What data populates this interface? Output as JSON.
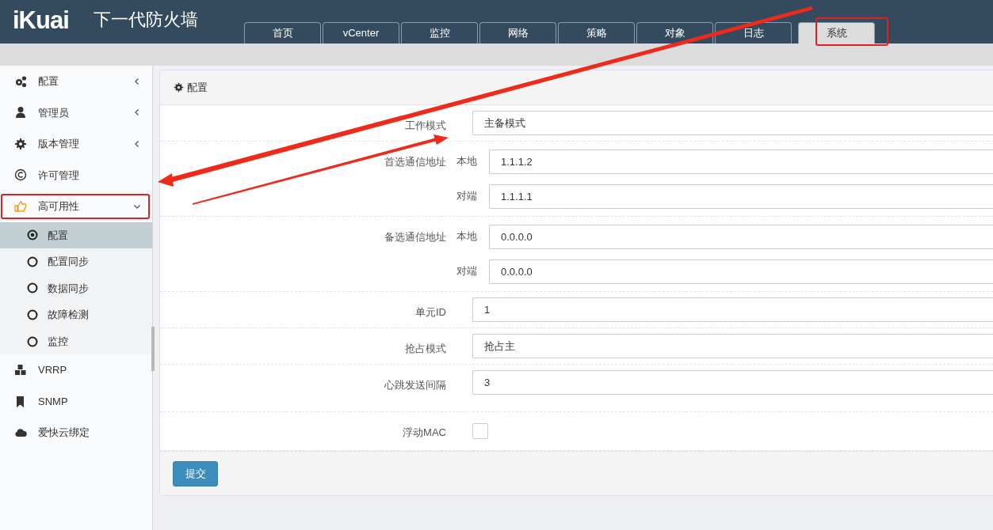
{
  "header": {
    "logo": "iKuai",
    "title": "下一代防火墙",
    "tabs": [
      {
        "label": "首页",
        "selected": false
      },
      {
        "label": "vCenter",
        "selected": false
      },
      {
        "label": "监控",
        "selected": false
      },
      {
        "label": "网络",
        "selected": false
      },
      {
        "label": "策略",
        "selected": false
      },
      {
        "label": "对象",
        "selected": false
      },
      {
        "label": "日志",
        "selected": false
      },
      {
        "label": "系统",
        "selected": true
      }
    ]
  },
  "sidebar": {
    "items": [
      {
        "label": "配置",
        "expanded": false
      },
      {
        "label": "管理员",
        "expanded": false
      },
      {
        "label": "版本管理",
        "expanded": false
      },
      {
        "label": "许可管理"
      },
      {
        "label": "高可用性",
        "expanded": true,
        "children": [
          {
            "label": "配置",
            "selected": true
          },
          {
            "label": "配置同步",
            "selected": false
          },
          {
            "label": "数据同步",
            "selected": false
          },
          {
            "label": "故障检测",
            "selected": false
          },
          {
            "label": "监控",
            "selected": false
          }
        ]
      },
      {
        "label": "VRRP"
      },
      {
        "label": "SNMP"
      },
      {
        "label": "爱快云绑定"
      }
    ]
  },
  "panel": {
    "title": "配置",
    "fields": [
      {
        "kind": "input",
        "label": "工作模式",
        "value": "主备模式"
      },
      {
        "kind": "pair",
        "label": "首选通信地址",
        "rows": [
          {
            "label": "本地",
            "value": "1.1.1.2"
          },
          {
            "label": "对端",
            "value": "1.1.1.1"
          }
        ]
      },
      {
        "kind": "pair",
        "label": "备选通信地址",
        "rows": [
          {
            "label": "本地",
            "value": "0.0.0.0"
          },
          {
            "label": "对端",
            "value": "0.0.0.0"
          }
        ]
      },
      {
        "kind": "input",
        "label": "单元ID",
        "value": "1"
      },
      {
        "kind": "input",
        "label": "抢占模式",
        "value": "抢占主"
      },
      {
        "kind": "input",
        "label": "心跳发送间隔",
        "value": "3"
      },
      {
        "kind": "checkbox",
        "label": "浮动MAC",
        "checked": false
      }
    ],
    "submit": "提交"
  }
}
